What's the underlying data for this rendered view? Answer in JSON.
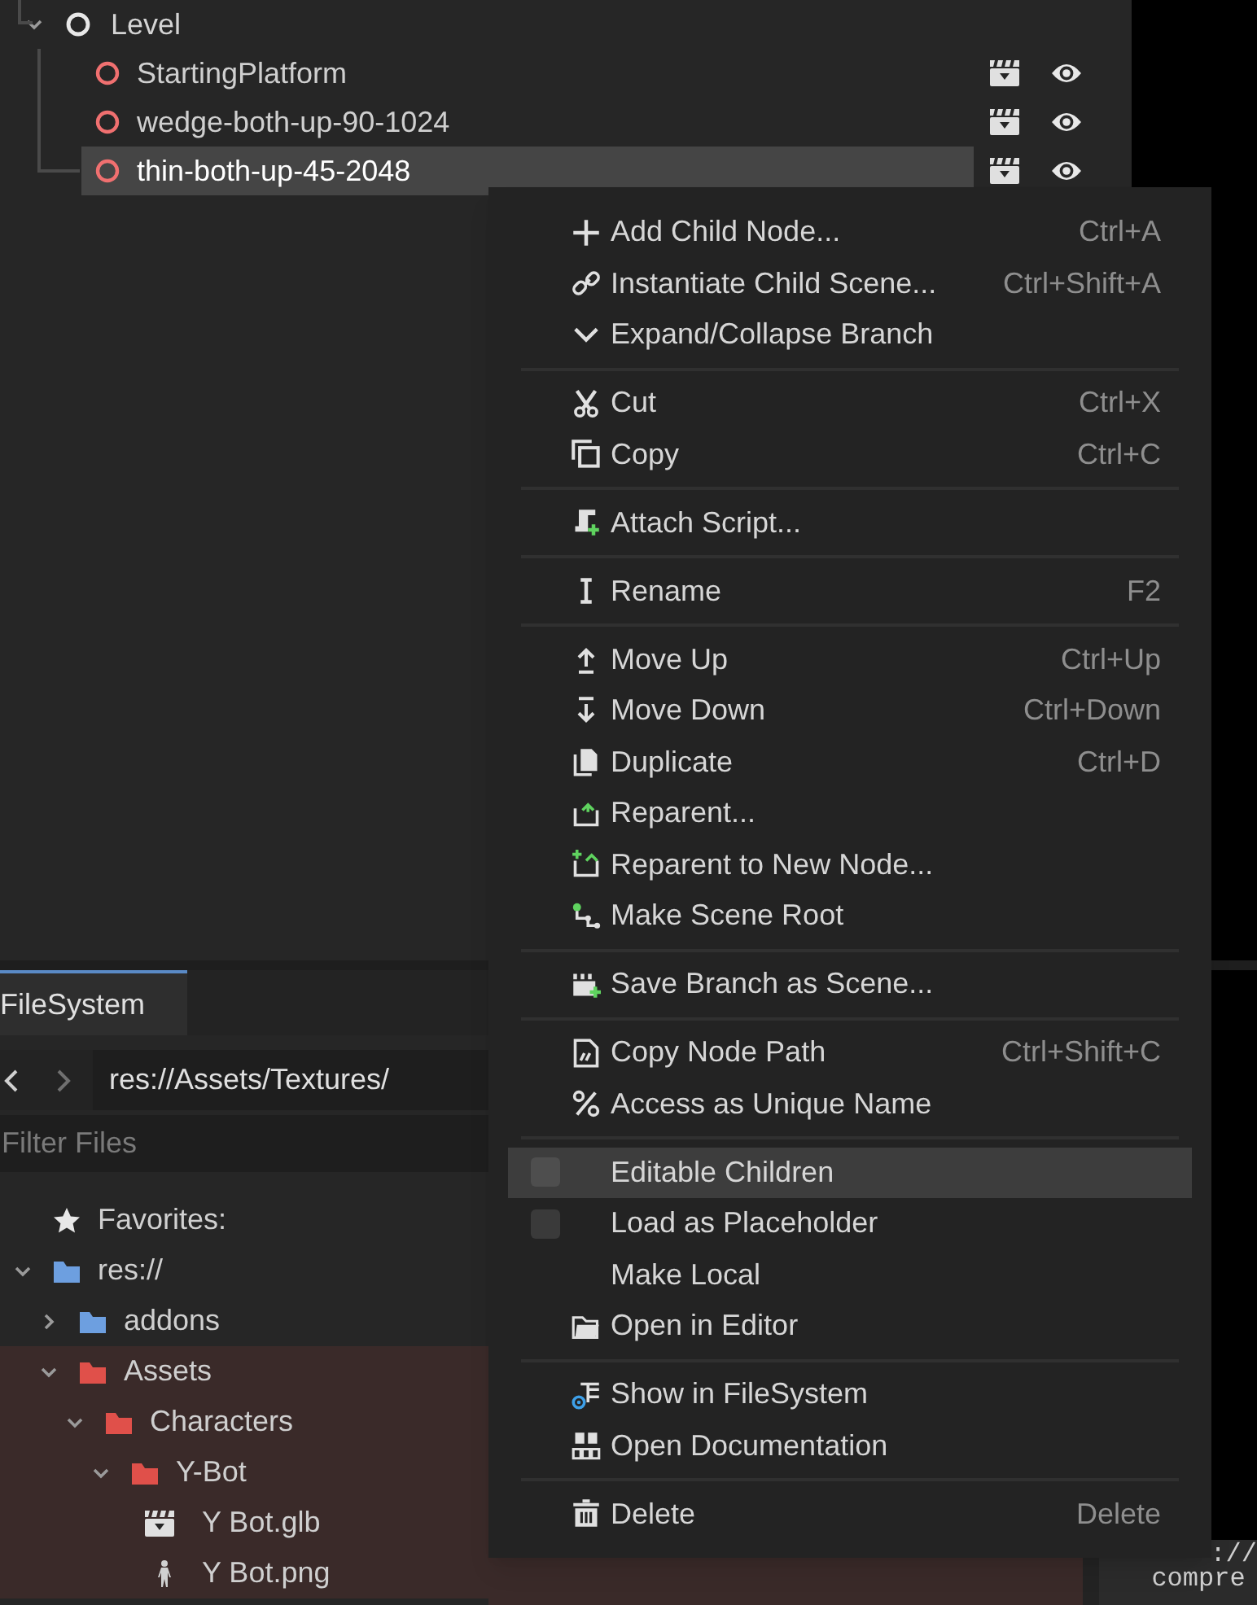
{
  "scene_tree": {
    "items": [
      {
        "label": "Level",
        "selected": false,
        "expanded": true,
        "children": [
          {
            "label": "StartingPlatform",
            "selected": false,
            "visible": true
          },
          {
            "label": "wedge-both-up-90-1024",
            "selected": false,
            "visible": true
          },
          {
            "label": "thin-both-up-45-2048",
            "selected": true,
            "visible": true
          }
        ]
      }
    ]
  },
  "filesystem": {
    "tabs": [
      {
        "label": "FileSystem",
        "selected": true
      }
    ],
    "path": "res://Assets/Textures/",
    "filter_placeholder": "Filter Files",
    "tree": [
      {
        "kind": "favorites",
        "label": "Favorites:"
      },
      {
        "kind": "folder",
        "label": "res://",
        "expanded": true,
        "color": "#6d9fe0",
        "children": [
          {
            "kind": "folder",
            "label": "addons",
            "expanded": false,
            "color": "#6d9fe0"
          },
          {
            "kind": "folder",
            "label": "Assets",
            "expanded": true,
            "color": "#e0504a",
            "children": [
              {
                "kind": "folder",
                "label": "Characters",
                "expanded": true,
                "color": "#e0504a",
                "children": [
                  {
                    "kind": "folder",
                    "label": "Y-Bot",
                    "expanded": true,
                    "color": "#e0504a",
                    "children": [
                      {
                        "kind": "scene",
                        "label": "Y Bot.glb"
                      },
                      {
                        "kind": "image",
                        "label": "Y Bot.png"
                      }
                    ]
                  }
                ]
              }
            ]
          }
        ]
      }
    ]
  },
  "output": {
    "lines": [
      "://",
      "compre"
    ]
  },
  "context_menu": {
    "items": [
      {
        "kind": "action",
        "label": "Add Child Node...",
        "shortcut": "Ctrl+A",
        "highlighted": false
      },
      {
        "kind": "action",
        "label": "Instantiate Child Scene...",
        "shortcut": "Ctrl+Shift+A",
        "highlighted": false
      },
      {
        "kind": "action",
        "label": "Expand/Collapse Branch",
        "highlighted": false
      },
      {
        "kind": "separator"
      },
      {
        "kind": "action",
        "label": "Cut",
        "shortcut": "Ctrl+X",
        "highlighted": false
      },
      {
        "kind": "action",
        "label": "Copy",
        "shortcut": "Ctrl+C",
        "highlighted": false
      },
      {
        "kind": "separator"
      },
      {
        "kind": "action",
        "label": "Attach Script...",
        "highlighted": false
      },
      {
        "kind": "separator"
      },
      {
        "kind": "action",
        "label": "Rename",
        "shortcut": "F2",
        "highlighted": false
      },
      {
        "kind": "separator"
      },
      {
        "kind": "action",
        "label": "Move Up",
        "shortcut": "Ctrl+Up",
        "highlighted": false
      },
      {
        "kind": "action",
        "label": "Move Down",
        "shortcut": "Ctrl+Down",
        "highlighted": false
      },
      {
        "kind": "action",
        "label": "Duplicate",
        "shortcut": "Ctrl+D",
        "highlighted": false
      },
      {
        "kind": "action",
        "label": "Reparent...",
        "highlighted": false
      },
      {
        "kind": "action",
        "label": "Reparent to New Node...",
        "highlighted": false
      },
      {
        "kind": "action",
        "label": "Make Scene Root",
        "highlighted": false
      },
      {
        "kind": "separator"
      },
      {
        "kind": "action",
        "label": "Save Branch as Scene...",
        "highlighted": false
      },
      {
        "kind": "separator"
      },
      {
        "kind": "action",
        "label": "Copy Node Path",
        "shortcut": "Ctrl+Shift+C",
        "highlighted": false
      },
      {
        "kind": "action",
        "label": "Access as Unique Name",
        "highlighted": false
      },
      {
        "kind": "separator"
      },
      {
        "kind": "checkbox",
        "label": "Editable Children",
        "checked": false,
        "highlighted": true
      },
      {
        "kind": "checkbox",
        "label": "Load as Placeholder",
        "checked": false,
        "highlighted": false
      },
      {
        "kind": "action",
        "label": "Make Local",
        "highlighted": false
      },
      {
        "kind": "action",
        "label": "Open in Editor",
        "highlighted": false
      },
      {
        "kind": "separator"
      },
      {
        "kind": "action",
        "label": "Show in FileSystem",
        "highlighted": false
      },
      {
        "kind": "action",
        "label": "Open Documentation",
        "highlighted": false
      },
      {
        "kind": "separator"
      },
      {
        "kind": "action",
        "label": "Delete",
        "shortcut": "Delete",
        "highlighted": false
      }
    ]
  }
}
